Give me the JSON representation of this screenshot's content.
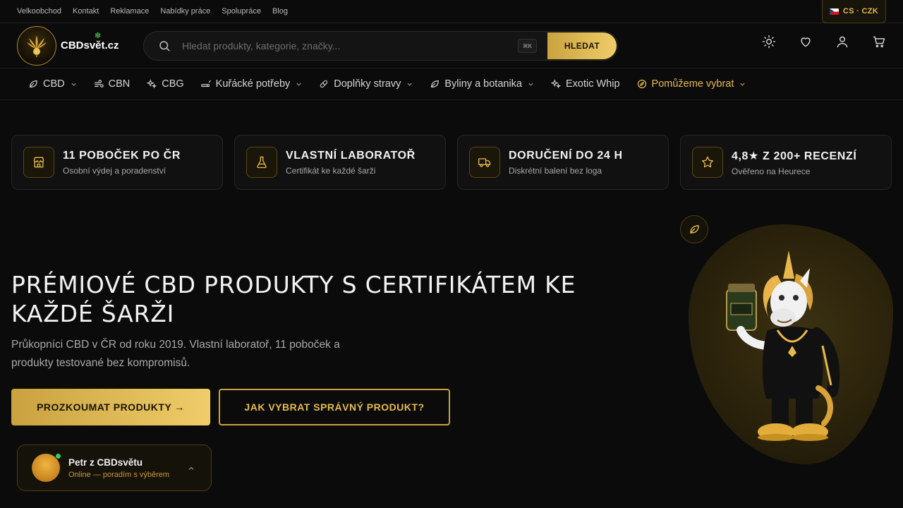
{
  "topbar": {
    "links": [
      "Velkoobchod",
      "Kontakt",
      "Reklamace",
      "Nabídky práce",
      "Spolupráce",
      "Blog"
    ],
    "locale": "CS · CZK"
  },
  "header": {
    "logo_text": "CBDsvět.cz",
    "search_placeholder": "Hledat produkty, kategorie, značky...",
    "shortcut": "⌘K",
    "search_button": "HLEDAT"
  },
  "nav": [
    {
      "label": "CBD",
      "icon": "leaf-icon",
      "dropdown": true
    },
    {
      "label": "CBN",
      "icon": "wind-icon",
      "dropdown": false
    },
    {
      "label": "CBG",
      "icon": "sparkle-icon",
      "dropdown": false
    },
    {
      "label": "Kuřácké potřeby",
      "icon": "cigarette-icon",
      "dropdown": true
    },
    {
      "label": "Doplňky stravy",
      "icon": "pill-icon",
      "dropdown": true
    },
    {
      "label": "Byliny a botanika",
      "icon": "leaf-icon",
      "dropdown": true
    },
    {
      "label": "Exotic Whip",
      "icon": "sparkle-icon",
      "dropdown": false
    },
    {
      "label": "Pomůžeme vybrat",
      "icon": "compass-icon",
      "dropdown": true
    }
  ],
  "features": [
    {
      "title": "11 POBOČEK PO ČR",
      "subtitle": "Osobní výdej a poradenství",
      "icon": "store-icon"
    },
    {
      "title": "VLASTNÍ LABORATOŘ",
      "subtitle": "Certifikát ke každé šarži",
      "icon": "flask-icon"
    },
    {
      "title": "DORUČENÍ DO 24 H",
      "subtitle": "Diskrétní balení bez loga",
      "icon": "truck-icon"
    },
    {
      "title": "4,8★ Z 200+ RECENZÍ",
      "subtitle": "Ověřeno na Heurece",
      "icon": "star-icon"
    }
  ],
  "hero": {
    "title": "PRÉMIOVÉ CBD PRODUKTY S CERTIFIKÁTEM KE KAŽDÉ ŠARŽI",
    "subtitle": "Průkopníci CBD v ČR od roku 2019. Vlastní laboratoř, 11 poboček a produkty testované bez kompromisů.",
    "primary_button": "PROZKOUMAT PRODUKTY →",
    "secondary_button": "JAK VYBRAT SPRÁVNÝ PRODUKT?"
  },
  "chat": {
    "name": "Petr z CBDsvětu",
    "status": "Online — poradím s výběrem"
  },
  "colors": {
    "accent_gold": "#e8bc4a",
    "background": "#0b0b0b",
    "online": "#35d05a"
  }
}
